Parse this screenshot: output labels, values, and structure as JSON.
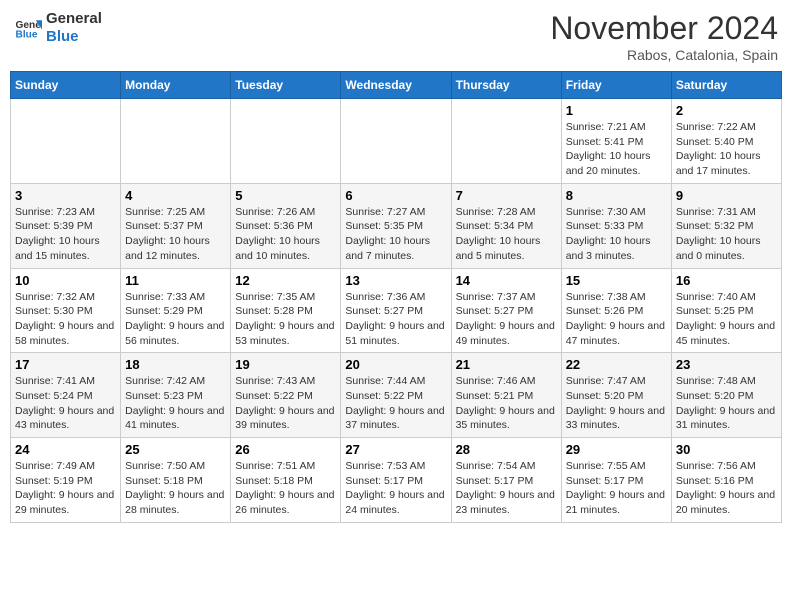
{
  "header": {
    "logo_general": "General",
    "logo_blue": "Blue",
    "month": "November 2024",
    "location": "Rabos, Catalonia, Spain"
  },
  "days_of_week": [
    "Sunday",
    "Monday",
    "Tuesday",
    "Wednesday",
    "Thursday",
    "Friday",
    "Saturday"
  ],
  "weeks": [
    [
      {
        "day": "",
        "info": ""
      },
      {
        "day": "",
        "info": ""
      },
      {
        "day": "",
        "info": ""
      },
      {
        "day": "",
        "info": ""
      },
      {
        "day": "",
        "info": ""
      },
      {
        "day": "1",
        "info": "Sunrise: 7:21 AM\nSunset: 5:41 PM\nDaylight: 10 hours and 20 minutes."
      },
      {
        "day": "2",
        "info": "Sunrise: 7:22 AM\nSunset: 5:40 PM\nDaylight: 10 hours and 17 minutes."
      }
    ],
    [
      {
        "day": "3",
        "info": "Sunrise: 7:23 AM\nSunset: 5:39 PM\nDaylight: 10 hours and 15 minutes."
      },
      {
        "day": "4",
        "info": "Sunrise: 7:25 AM\nSunset: 5:37 PM\nDaylight: 10 hours and 12 minutes."
      },
      {
        "day": "5",
        "info": "Sunrise: 7:26 AM\nSunset: 5:36 PM\nDaylight: 10 hours and 10 minutes."
      },
      {
        "day": "6",
        "info": "Sunrise: 7:27 AM\nSunset: 5:35 PM\nDaylight: 10 hours and 7 minutes."
      },
      {
        "day": "7",
        "info": "Sunrise: 7:28 AM\nSunset: 5:34 PM\nDaylight: 10 hours and 5 minutes."
      },
      {
        "day": "8",
        "info": "Sunrise: 7:30 AM\nSunset: 5:33 PM\nDaylight: 10 hours and 3 minutes."
      },
      {
        "day": "9",
        "info": "Sunrise: 7:31 AM\nSunset: 5:32 PM\nDaylight: 10 hours and 0 minutes."
      }
    ],
    [
      {
        "day": "10",
        "info": "Sunrise: 7:32 AM\nSunset: 5:30 PM\nDaylight: 9 hours and 58 minutes."
      },
      {
        "day": "11",
        "info": "Sunrise: 7:33 AM\nSunset: 5:29 PM\nDaylight: 9 hours and 56 minutes."
      },
      {
        "day": "12",
        "info": "Sunrise: 7:35 AM\nSunset: 5:28 PM\nDaylight: 9 hours and 53 minutes."
      },
      {
        "day": "13",
        "info": "Sunrise: 7:36 AM\nSunset: 5:27 PM\nDaylight: 9 hours and 51 minutes."
      },
      {
        "day": "14",
        "info": "Sunrise: 7:37 AM\nSunset: 5:27 PM\nDaylight: 9 hours and 49 minutes."
      },
      {
        "day": "15",
        "info": "Sunrise: 7:38 AM\nSunset: 5:26 PM\nDaylight: 9 hours and 47 minutes."
      },
      {
        "day": "16",
        "info": "Sunrise: 7:40 AM\nSunset: 5:25 PM\nDaylight: 9 hours and 45 minutes."
      }
    ],
    [
      {
        "day": "17",
        "info": "Sunrise: 7:41 AM\nSunset: 5:24 PM\nDaylight: 9 hours and 43 minutes."
      },
      {
        "day": "18",
        "info": "Sunrise: 7:42 AM\nSunset: 5:23 PM\nDaylight: 9 hours and 41 minutes."
      },
      {
        "day": "19",
        "info": "Sunrise: 7:43 AM\nSunset: 5:22 PM\nDaylight: 9 hours and 39 minutes."
      },
      {
        "day": "20",
        "info": "Sunrise: 7:44 AM\nSunset: 5:22 PM\nDaylight: 9 hours and 37 minutes."
      },
      {
        "day": "21",
        "info": "Sunrise: 7:46 AM\nSunset: 5:21 PM\nDaylight: 9 hours and 35 minutes."
      },
      {
        "day": "22",
        "info": "Sunrise: 7:47 AM\nSunset: 5:20 PM\nDaylight: 9 hours and 33 minutes."
      },
      {
        "day": "23",
        "info": "Sunrise: 7:48 AM\nSunset: 5:20 PM\nDaylight: 9 hours and 31 minutes."
      }
    ],
    [
      {
        "day": "24",
        "info": "Sunrise: 7:49 AM\nSunset: 5:19 PM\nDaylight: 9 hours and 29 minutes."
      },
      {
        "day": "25",
        "info": "Sunrise: 7:50 AM\nSunset: 5:18 PM\nDaylight: 9 hours and 28 minutes."
      },
      {
        "day": "26",
        "info": "Sunrise: 7:51 AM\nSunset: 5:18 PM\nDaylight: 9 hours and 26 minutes."
      },
      {
        "day": "27",
        "info": "Sunrise: 7:53 AM\nSunset: 5:17 PM\nDaylight: 9 hours and 24 minutes."
      },
      {
        "day": "28",
        "info": "Sunrise: 7:54 AM\nSunset: 5:17 PM\nDaylight: 9 hours and 23 minutes."
      },
      {
        "day": "29",
        "info": "Sunrise: 7:55 AM\nSunset: 5:17 PM\nDaylight: 9 hours and 21 minutes."
      },
      {
        "day": "30",
        "info": "Sunrise: 7:56 AM\nSunset: 5:16 PM\nDaylight: 9 hours and 20 minutes."
      }
    ]
  ]
}
